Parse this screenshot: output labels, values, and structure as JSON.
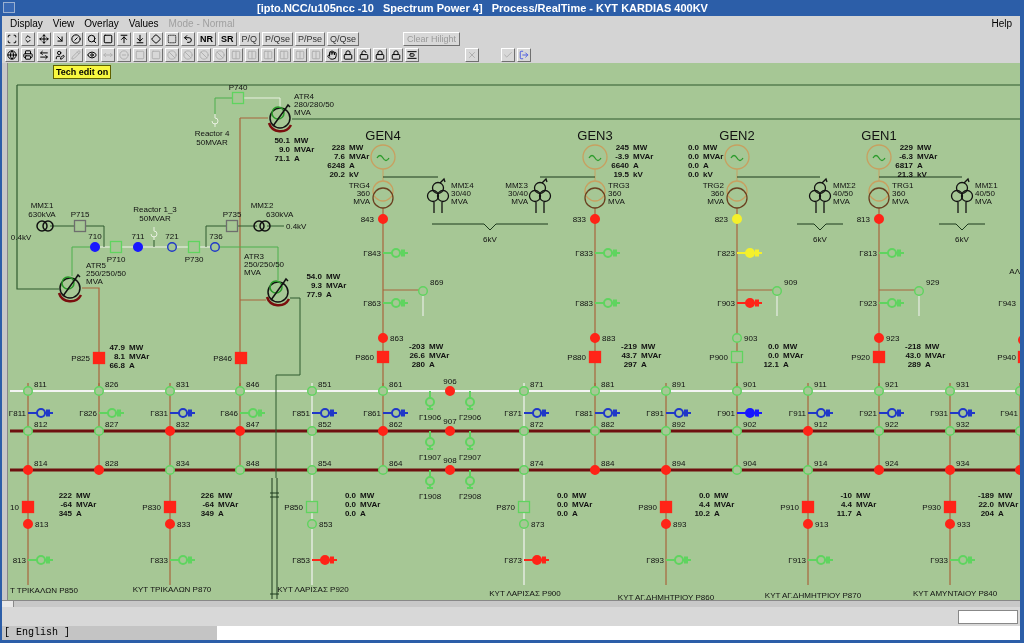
{
  "window": {
    "title": "[ipto.NCC/u105ncc -10   Spectrum Power 4]   Process/RealTime - KYT KARDIAS 400KV"
  },
  "menu": [
    {
      "label": "Display",
      "disabled": false
    },
    {
      "label": "View",
      "disabled": false
    },
    {
      "label": "Overlay",
      "disabled": false
    },
    {
      "label": "Values",
      "disabled": false
    },
    {
      "label": "Mode - Normal",
      "disabled": true
    },
    {
      "label": "Help",
      "disabled": false
    }
  ],
  "toolbar_1": {
    "buttons": [
      {
        "label": "NR",
        "kind": "mode"
      },
      {
        "label": "SR",
        "kind": "mode"
      },
      {
        "label": "P/Q",
        "kind": "view"
      },
      {
        "label": "P/Qse",
        "kind": "view"
      },
      {
        "label": "P/Pse",
        "kind": "view"
      },
      {
        "label": "Q/Qse",
        "kind": "view"
      }
    ],
    "clear_button": {
      "label": "Clear Hilight",
      "disabled": true
    }
  },
  "toolbar_2": [
    {
      "disabled": false
    },
    {
      "disabled": false
    },
    {
      "disabled": false
    },
    {
      "disabled": false
    },
    {
      "disabled": true
    },
    {
      "disabled": false
    },
    {
      "disabled": true
    },
    {
      "disabled": true
    },
    {
      "disabled": true
    },
    {
      "disabled": true
    },
    {
      "disabled": true
    },
    {
      "disabled": true
    },
    {
      "disabled": true
    },
    {
      "disabled": true
    },
    {
      "disabled": true
    },
    {
      "disabled": true
    },
    {
      "disabled": true
    },
    {
      "disabled": true
    },
    {
      "disabled": true
    },
    {
      "disabled": true
    },
    {
      "disabled": false
    },
    {
      "disabled": false
    },
    {
      "disabled": false
    },
    {
      "disabled": false
    },
    {
      "disabled": false
    },
    {
      "disabled": false
    },
    {
      "disabled": true
    },
    {
      "disabled": true
    },
    {
      "disabled": false
    }
  ],
  "tooltip": "Tech edit on",
  "upper_left": {
    "atr_units": [
      {
        "name": "ATR4",
        "rating": "280/280/50",
        "unit": "MVA",
        "readings": [
          {
            "value": "50.1",
            "unit": "MW"
          },
          {
            "value": "9.0",
            "unit": "MVAr"
          },
          {
            "value": "71.1",
            "unit": "A"
          }
        ]
      },
      {
        "name": "ATR5",
        "rating": "250/250/50",
        "unit": "MVA"
      },
      {
        "name": "ATR3",
        "rating": "250/250/50",
        "unit": "MVA",
        "readings": [
          {
            "value": "54.0",
            "unit": "MW"
          },
          {
            "value": "9.3",
            "unit": "MVAr"
          },
          {
            "value": "77.9",
            "unit": "A"
          }
        ]
      }
    ],
    "reactors": [
      {
        "name": "Reactor 4",
        "rating": "50MVAR"
      },
      {
        "name": "Reactor 1_3",
        "rating": "50MVAR"
      }
    ],
    "aux_transformers": [
      {
        "name": "ΜΜΣ1",
        "rating": "630kVA",
        "voltage": "0.4kV"
      },
      {
        "name": "ΜΜΣ2",
        "rating": "630kVA",
        "voltage": "0.4kV"
      }
    ],
    "breakers": [
      {
        "label": "P740",
        "closed": false,
        "color": "#5fd45f"
      },
      {
        "label": "P715",
        "closed": false,
        "color": "#6e6e6e"
      },
      {
        "label": "P710",
        "closed": false,
        "color": "#5fd45f"
      },
      {
        "label": "P730",
        "closed": false,
        "color": "#5fd45f"
      },
      {
        "label": "P735",
        "closed": false,
        "color": "#6e6e6e"
      },
      {
        "label": "P825",
        "closed": true,
        "color": "#ff2418"
      },
      {
        "label": "P846",
        "closed": true,
        "color": "#ff2418"
      }
    ],
    "nodes": [
      {
        "label": "710",
        "closed": true,
        "color": "#1818ff"
      },
      {
        "label": "711",
        "closed": true,
        "color": "#1818ff"
      },
      {
        "label": "721",
        "closed": false,
        "color": "#2038c8"
      },
      {
        "label": "736",
        "closed": false,
        "color": "#2038c8"
      }
    ],
    "breaker_readings": [
      {
        "value": "47.9",
        "unit": "MW"
      },
      {
        "value": "8.1",
        "unit": "MVAr"
      },
      {
        "value": "66.8",
        "unit": "A"
      }
    ]
  },
  "generators": [
    {
      "name": "GEN4",
      "readings": [
        {
          "value": "228",
          "unit": "MW"
        },
        {
          "value": "7.6",
          "unit": "MVAr"
        },
        {
          "value": "6248",
          "unit": "A"
        },
        {
          "value": "20.2",
          "unit": "kV"
        }
      ],
      "transformer": [
        "TRG4",
        "360",
        "MVA"
      ],
      "aux_transformer": [
        "ΜΜΣ4",
        "30/40",
        "MVA"
      ],
      "top_node": {
        "label": "843",
        "closed": true,
        "color": "#ff2418"
      },
      "top_isolator": {
        "label": "Γ843",
        "closed": false,
        "color": "#5fd45f"
      },
      "branch_node": {
        "label": "869",
        "closed": false,
        "color": "#5fd45f"
      },
      "mid_isolator": {
        "label": "Γ863",
        "closed": false,
        "color": "#5fd45f"
      },
      "bottom_node": {
        "label": "863",
        "closed": true,
        "color": "#ff2418"
      },
      "breaker": {
        "label": "P860",
        "closed": true,
        "color": "#ff2418"
      },
      "breaker_readings": [
        {
          "value": "-203",
          "unit": "MW"
        },
        {
          "value": "26.6",
          "unit": "MVAr"
        },
        {
          "value": "280",
          "unit": "A"
        }
      ]
    },
    {
      "name": "GEN3",
      "readings": [
        {
          "value": "245",
          "unit": "MW"
        },
        {
          "value": "-3.9",
          "unit": "MVAr"
        },
        {
          "value": "6640",
          "unit": "A"
        },
        {
          "value": "19.5",
          "unit": "kV"
        }
      ],
      "transformer": [
        "TRG3",
        "360",
        "MVA"
      ],
      "aux_transformer": [
        "ΜΜΣ3",
        "30/40",
        "MVA"
      ],
      "top_node": {
        "label": "833",
        "closed": true,
        "color": "#ff2418"
      },
      "top_isolator": {
        "label": "Γ833",
        "closed": false,
        "color": "#5fd45f"
      },
      "mid_isolator": {
        "label": "Γ883",
        "closed": false,
        "color": "#5fd45f"
      },
      "bottom_node": {
        "label": "883",
        "closed": true,
        "color": "#ff2418"
      },
      "breaker": {
        "label": "P880",
        "closed": true,
        "color": "#ff2418"
      },
      "breaker_readings": [
        {
          "value": "-219",
          "unit": "MW"
        },
        {
          "value": "43.7",
          "unit": "MVAr"
        },
        {
          "value": "297",
          "unit": "A"
        }
      ]
    },
    {
      "name": "GEN2",
      "readings": [
        {
          "value": "0.0",
          "unit": "MW"
        },
        {
          "value": "0.0",
          "unit": "MVAr"
        },
        {
          "value": "0.0",
          "unit": "A"
        },
        {
          "value": "0.0",
          "unit": "kV"
        }
      ],
      "transformer": [
        "TRG2",
        "360",
        "MVA"
      ],
      "aux_transformer": [
        "ΜΜΣ2",
        "40/50",
        "MVA"
      ],
      "top_node": {
        "label": "823",
        "closed": true,
        "color": "#f4f02c"
      },
      "top_isolator": {
        "label": "Γ823",
        "closed": true,
        "color": "#f4f02c"
      },
      "branch_node": {
        "label": "909",
        "closed": false,
        "color": "#5fd45f"
      },
      "mid_isolator": {
        "label": "Γ903",
        "closed": true,
        "color": "#ff2418"
      },
      "bottom_node": {
        "label": "903",
        "closed": false,
        "color": "#5fd45f"
      },
      "breaker": {
        "label": "P900",
        "closed": false,
        "color": "#5fd45f"
      },
      "breaker_readings": [
        {
          "value": "0.0",
          "unit": "MW"
        },
        {
          "value": "0.0",
          "unit": "MVAr"
        },
        {
          "value": "12.1",
          "unit": "A"
        }
      ]
    },
    {
      "name": "GEN1",
      "readings": [
        {
          "value": "229",
          "unit": "MW"
        },
        {
          "value": "-6.3",
          "unit": "MVAr"
        },
        {
          "value": "6817",
          "unit": "A"
        },
        {
          "value": "21.3",
          "unit": "kV"
        }
      ],
      "transformer": [
        "TRG1",
        "360",
        "MVA"
      ],
      "aux_transformer": [
        "ΜΜΣ1",
        "40/50",
        "MVA"
      ],
      "top_node": {
        "label": "813",
        "closed": true,
        "color": "#ff2418"
      },
      "top_isolator": {
        "label": "Γ813",
        "closed": false,
        "color": "#5fd45f"
      },
      "branch_node": {
        "label": "929",
        "closed": false,
        "color": "#5fd45f"
      },
      "mid_isolator": {
        "label": "Γ923",
        "closed": false,
        "color": "#5fd45f"
      },
      "bottom_node": {
        "label": "923",
        "closed": true,
        "color": "#ff2418"
      },
      "breaker": {
        "label": "P920",
        "closed": true,
        "color": "#ff2418"
      },
      "breaker_readings": [
        {
          "value": "-218",
          "unit": "MW"
        },
        {
          "value": "43.0",
          "unit": "MVAr"
        },
        {
          "value": "289",
          "unit": "A"
        }
      ]
    }
  ],
  "aux_buses": [
    {
      "voltage": "6kV"
    },
    {
      "voltage": "6kV"
    },
    {
      "voltage": "6kV"
    }
  ],
  "edge_bay": {
    "text": "ΑΛ",
    "isolator": {
      "label": "Γ943"
    },
    "node": {
      "closed": true,
      "color": "#ff2418"
    },
    "breaker": {
      "label": "P940",
      "closed": true,
      "color": "#ff2418"
    }
  },
  "bays": [
    {
      "nodes": [
        {
          "label": "811",
          "closed": false,
          "color": "#5fd45f"
        },
        {
          "label": "812",
          "closed": false,
          "color": "#5fd45f"
        },
        {
          "label": "814",
          "closed": true,
          "color": "#ff2418"
        }
      ],
      "isolator": {
        "label": "Γ811",
        "closed": false,
        "color": "#2038c8"
      },
      "feeder": {
        "breaker": {
          "label": "10",
          "closed": true,
          "color": "#ff2418"
        },
        "readings": [
          {
            "value": "222",
            "unit": "MW"
          },
          {
            "value": "-64",
            "unit": "MVAr"
          },
          {
            "value": "345",
            "unit": "A"
          }
        ],
        "node": {
          "label": "813",
          "closed": true,
          "color": "#ff2418"
        },
        "isolator": {
          "label": "813",
          "closed": false,
          "color": "#5fd45f"
        },
        "name": "Τ ΤΡΙΚΑΛΩΝ P850"
      }
    },
    {
      "nodes": [
        {
          "label": "826",
          "closed": false,
          "color": "#5fd45f"
        },
        {
          "label": "827",
          "closed": false,
          "color": "#5fd45f"
        },
        {
          "label": "828",
          "closed": true,
          "color": "#ff2418"
        }
      ],
      "isolator": {
        "label": "Γ826",
        "closed": false,
        "color": "#5fd45f"
      }
    },
    {
      "nodes": [
        {
          "label": "831",
          "closed": false,
          "color": "#5fd45f"
        },
        {
          "label": "832",
          "closed": true,
          "color": "#ff2418"
        },
        {
          "label": "834",
          "closed": false,
          "color": "#5fd45f"
        }
      ],
      "isolator": {
        "label": "Γ831",
        "closed": false,
        "color": "#2038c8"
      },
      "feeder": {
        "breaker": {
          "label": "P830",
          "closed": true,
          "color": "#ff2418"
        },
        "readings": [
          {
            "value": "226",
            "unit": "MW"
          },
          {
            "value": "-64",
            "unit": "MVAr"
          },
          {
            "value": "349",
            "unit": "A"
          }
        ],
        "node": {
          "label": "833",
          "closed": true,
          "color": "#ff2418"
        },
        "isolator": {
          "label": "Γ833",
          "closed": false,
          "color": "#5fd45f"
        },
        "name": "ΚΥΤ ΤΡΙΚΑΛΩΝ P870"
      }
    },
    {
      "nodes": [
        {
          "label": "846",
          "closed": false,
          "color": "#5fd45f"
        },
        {
          "label": "847",
          "closed": true,
          "color": "#ff2418"
        },
        {
          "label": "848",
          "closed": false,
          "color": "#5fd45f"
        }
      ],
      "isolator": {
        "label": "Γ846",
        "closed": false,
        "color": "#5fd45f"
      }
    },
    {
      "nodes": [
        {
          "label": "851",
          "closed": false,
          "color": "#5fd45f"
        },
        {
          "label": "852",
          "closed": false,
          "color": "#5fd45f"
        },
        {
          "label": "854",
          "closed": false,
          "color": "#5fd45f"
        }
      ],
      "isolator": {
        "label": "Γ851",
        "closed": false,
        "color": "#2038c8"
      },
      "feeder": {
        "breaker": {
          "label": "P850",
          "closed": false,
          "color": "#5fd45f"
        },
        "readings": [
          {
            "value": "0.0",
            "unit": "MW"
          },
          {
            "value": "0.0",
            "unit": "MVAr"
          },
          {
            "value": "0.0",
            "unit": "A"
          }
        ],
        "node": {
          "label": "853",
          "closed": false,
          "color": "#5fd45f"
        },
        "isolator": {
          "label": "Γ853",
          "closed": true,
          "color": "#ff2418"
        },
        "name": "ΚΥΤ ΛΑΡΙΣΑΣ P920"
      }
    },
    {
      "nodes": [
        {
          "label": "861",
          "closed": false,
          "color": "#5fd45f"
        },
        {
          "label": "862",
          "closed": true,
          "color": "#ff2418"
        },
        {
          "label": "864",
          "closed": false,
          "color": "#5fd45f"
        }
      ],
      "isolator": {
        "label": "Γ861",
        "closed": false,
        "color": "#2038c8"
      }
    },
    {
      "nodes": [
        {
          "label": "871",
          "closed": false,
          "color": "#5fd45f"
        },
        {
          "label": "872",
          "closed": false,
          "color": "#5fd45f"
        },
        {
          "label": "874",
          "closed": false,
          "color": "#5fd45f"
        }
      ],
      "isolator": {
        "label": "Γ871",
        "closed": false,
        "color": "#2038c8"
      },
      "feeder": {
        "breaker": {
          "label": "P870",
          "closed": false,
          "color": "#5fd45f"
        },
        "readings": [
          {
            "value": "0.0",
            "unit": "MW"
          },
          {
            "value": "0.0",
            "unit": "MVAr"
          },
          {
            "value": "0.0",
            "unit": "A"
          }
        ],
        "node": {
          "label": "873",
          "closed": false,
          "color": "#5fd45f"
        },
        "isolator": {
          "label": "Γ873",
          "closed": true,
          "color": "#ff2418"
        },
        "name": "ΚΥΤ ΛΑΡΙΣΑΣ P900"
      }
    },
    {
      "nodes": [
        {
          "label": "881",
          "closed": false,
          "color": "#5fd45f"
        },
        {
          "label": "882",
          "closed": false,
          "color": "#5fd45f"
        },
        {
          "label": "884",
          "closed": true,
          "color": "#ff2418"
        }
      ],
      "isolator": {
        "label": "Γ881",
        "closed": false,
        "color": "#2038c8"
      }
    },
    {
      "nodes": [
        {
          "label": "891",
          "closed": false,
          "color": "#5fd45f"
        },
        {
          "label": "892",
          "closed": false,
          "color": "#5fd45f"
        },
        {
          "label": "894",
          "closed": true,
          "color": "#ff2418"
        }
      ],
      "isolator": {
        "label": "Γ891",
        "closed": false,
        "color": "#2038c8"
      },
      "feeder": {
        "breaker": {
          "label": "P890",
          "closed": true,
          "color": "#ff2418"
        },
        "readings": [
          {
            "value": "0.0",
            "unit": "MW"
          },
          {
            "value": "4.4",
            "unit": "MVAr"
          },
          {
            "value": "10.2",
            "unit": "A"
          }
        ],
        "node": {
          "label": "893",
          "closed": true,
          "color": "#ff2418"
        },
        "isolator": {
          "label": "Γ893",
          "closed": false,
          "color": "#5fd45f"
        },
        "name": "ΚΥΤ ΑΓ.ΔΗΜΗΤΡΙΟΥ P860"
      }
    },
    {
      "nodes": [
        {
          "label": "901",
          "closed": false,
          "color": "#5fd45f"
        },
        {
          "label": "902",
          "closed": false,
          "color": "#5fd45f"
        },
        {
          "label": "904",
          "closed": false,
          "color": "#5fd45f"
        }
      ],
      "isolator": {
        "label": "Γ901",
        "closed": true,
        "color": "#1818ff"
      }
    },
    {
      "nodes": [
        {
          "label": "911",
          "closed": false,
          "color": "#5fd45f"
        },
        {
          "label": "912",
          "closed": true,
          "color": "#ff2418"
        },
        {
          "label": "914",
          "closed": false,
          "color": "#5fd45f"
        }
      ],
      "isolator": {
        "label": "Γ911",
        "closed": false,
        "color": "#2038c8"
      },
      "feeder": {
        "breaker": {
          "label": "P910",
          "closed": true,
          "color": "#ff2418"
        },
        "readings": [
          {
            "value": "-10",
            "unit": "MW"
          },
          {
            "value": "4.4",
            "unit": "MVAr"
          },
          {
            "value": "11.7",
            "unit": "A"
          }
        ],
        "node": {
          "label": "913",
          "closed": true,
          "color": "#ff2418"
        },
        "isolator": {
          "label": "Γ913",
          "closed": false,
          "color": "#5fd45f"
        },
        "name": "ΚΥΤ ΑΓ.ΔΗΜΗΤΡΙΟΥ P870"
      }
    },
    {
      "nodes": [
        {
          "label": "921",
          "closed": false,
          "color": "#5fd45f"
        },
        {
          "label": "922",
          "closed": false,
          "color": "#5fd45f"
        },
        {
          "label": "924",
          "closed": true,
          "color": "#ff2418"
        }
      ],
      "isolator": {
        "label": "Γ921",
        "closed": false,
        "color": "#2038c8"
      }
    },
    {
      "nodes": [
        {
          "label": "931",
          "closed": false,
          "color": "#5fd45f"
        },
        {
          "label": "932",
          "closed": false,
          "color": "#5fd45f"
        },
        {
          "label": "934",
          "closed": true,
          "color": "#ff2418"
        }
      ],
      "isolator": {
        "label": "Γ931",
        "closed": false,
        "color": "#2038c8"
      },
      "feeder": {
        "breaker": {
          "label": "P930",
          "closed": true,
          "color": "#ff2418"
        },
        "readings": [
          {
            "value": "-189",
            "unit": "MW"
          },
          {
            "value": "22.0",
            "unit": "MVAr"
          },
          {
            "value": "204",
            "unit": "A"
          }
        ],
        "node": {
          "label": "933",
          "closed": true,
          "color": "#ff2418"
        },
        "isolator": {
          "label": "Γ933",
          "closed": false,
          "color": "#5fd45f"
        },
        "name": "ΚΥΤ ΑΜΥΝΤΑΙΟΥ P840"
      }
    },
    {
      "nodes": [
        {
          "closed": false,
          "color": "#5fd45f"
        },
        {
          "closed": false,
          "color": "#5fd45f"
        },
        {
          "closed": true,
          "color": "#ff2418"
        }
      ],
      "isolator": {
        "label": "Γ941"
      }
    }
  ],
  "coupler": {
    "nodes": [
      {
        "label": "906",
        "closed": true,
        "color": "#ff2418"
      },
      {
        "label": "907",
        "closed": true,
        "color": "#ff2418"
      },
      {
        "label": "908",
        "closed": true,
        "color": "#ff2418"
      }
    ],
    "isolators": [
      {
        "label": "Γ1906",
        "closed": false,
        "color": "#5fd45f"
      },
      {
        "label": "Γ2906",
        "closed": false,
        "color": "#5fd45f"
      },
      {
        "label": "Γ1907",
        "closed": false,
        "color": "#5fd45f"
      },
      {
        "label": "Γ2907",
        "closed": false,
        "color": "#5fd45f"
      },
      {
        "label": "Γ1908",
        "closed": false,
        "color": "#5fd45f"
      },
      {
        "label": "Γ2908",
        "closed": false,
        "color": "#5fd45f"
      }
    ]
  },
  "status_bar": {
    "language": "[ English ]"
  }
}
